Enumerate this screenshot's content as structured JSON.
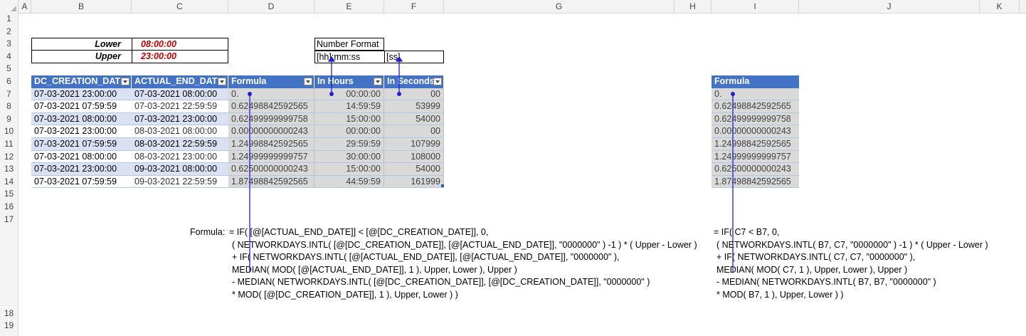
{
  "columns": [
    "A",
    "B",
    "C",
    "D",
    "E",
    "F",
    "G",
    "H",
    "I",
    "J",
    "K"
  ],
  "rows": [
    "1",
    "2",
    "3",
    "4",
    "5",
    "6",
    "7",
    "8",
    "9",
    "10",
    "11",
    "12",
    "13",
    "14",
    "15",
    "16",
    "17",
    "18",
    "19"
  ],
  "bounds": {
    "lower_label": "Lower",
    "lower_value": "08:00:00",
    "upper_label": "Upper",
    "upper_value": "23:00:00"
  },
  "number_format": {
    "title": "Number Format",
    "hours_format": "[hh]:mm:ss",
    "seconds_format": "[ss]"
  },
  "table": {
    "headers": [
      "DC_CREATION_DATE",
      "ACTUAL_END_DATE",
      "Formula",
      "In Hours",
      "In Seconds"
    ],
    "rows": [
      [
        "07-03-2021 23:00:00",
        "07-03-2021 08:00:00",
        "0.",
        "00:00:00",
        "00"
      ],
      [
        "07-03-2021 07:59:59",
        "07-03-2021 22:59:59",
        "0.62498842592565",
        "14:59:59",
        "53999"
      ],
      [
        "07-03-2021 08:00:00",
        "07-03-2021 23:00:00",
        "0.62499999999758",
        "15:00:00",
        "54000"
      ],
      [
        "07-03-2021 23:00:00",
        "08-03-2021 08:00:00",
        "0.00000000000243",
        "00:00:00",
        "00"
      ],
      [
        "07-03-2021 07:59:59",
        "08-03-2021 22:59:59",
        "1.24998842592565",
        "29:59:59",
        "107999"
      ],
      [
        "07-03-2021 08:00:00",
        "08-03-2021 23:00:00",
        "1.24999999999757",
        "30:00:00",
        "108000"
      ],
      [
        "07-03-2021 23:00:00",
        "09-03-2021 08:00:00",
        "0.62500000000243",
        "15:00:00",
        "54000"
      ],
      [
        "07-03-2021 07:59:59",
        "09-03-2021 22:59:59",
        "1.87498842592565",
        "44:59:59",
        "161999"
      ]
    ]
  },
  "formula_column": {
    "header": "Formula",
    "values": [
      "0.",
      "0.62498842592565",
      "0.62499999999758",
      "0.00000000000243",
      "1.24998842592565",
      "1.24999999999757",
      "0.62500000000243",
      "1.87498842592565"
    ]
  },
  "structured_formula": {
    "label": "Formula:",
    "lines": [
      "= IF( [@[ACTUAL_END_DATE]] < [@[DC_CREATION_DATE]], 0,",
      "( NETWORKDAYS.INTL( [@[DC_CREATION_DATE]], [@[ACTUAL_END_DATE]], \"0000000\" ) -1 ) * ( Upper - Lower )",
      "+ IF( NETWORKDAYS.INTL( [@[ACTUAL_END_DATE]], [@[ACTUAL_END_DATE]], \"0000000\" ),",
      "MEDIAN( MOD( [@[ACTUAL_END_DATE]], 1 ), Upper, Lower ), Upper )",
      "- MEDIAN( NETWORKDAYS.INTL( [@[DC_CREATION_DATE]], [@[DC_CREATION_DATE]], \"0000000\" )",
      "* MOD( [@[DC_CREATION_DATE]], 1 ), Upper, Lower ) )"
    ]
  },
  "cell_formula": {
    "lines": [
      "= IF( C7 < B7, 0,",
      "( NETWORKDAYS.INTL( B7, C7, \"0000000\" ) -1 ) * ( Upper - Lower )",
      "+ IF( NETWORKDAYS.INTL( C7, C7, \"0000000\" ),",
      "MEDIAN( MOD( C7, 1 ), Upper, Lower ), Upper )",
      "- MEDIAN( NETWORKDAYS.INTL( B7, B7, \"0000000\" )",
      "* MOD( B7, 1 ), Upper, Lower ) )"
    ]
  },
  "colors": {
    "header_blue": "#4472c4",
    "band_light": "#d9e1f2",
    "number_gray": "#d9d9d9",
    "arrow_blue": "#1f1fd0",
    "bound_red": "#c00000"
  }
}
